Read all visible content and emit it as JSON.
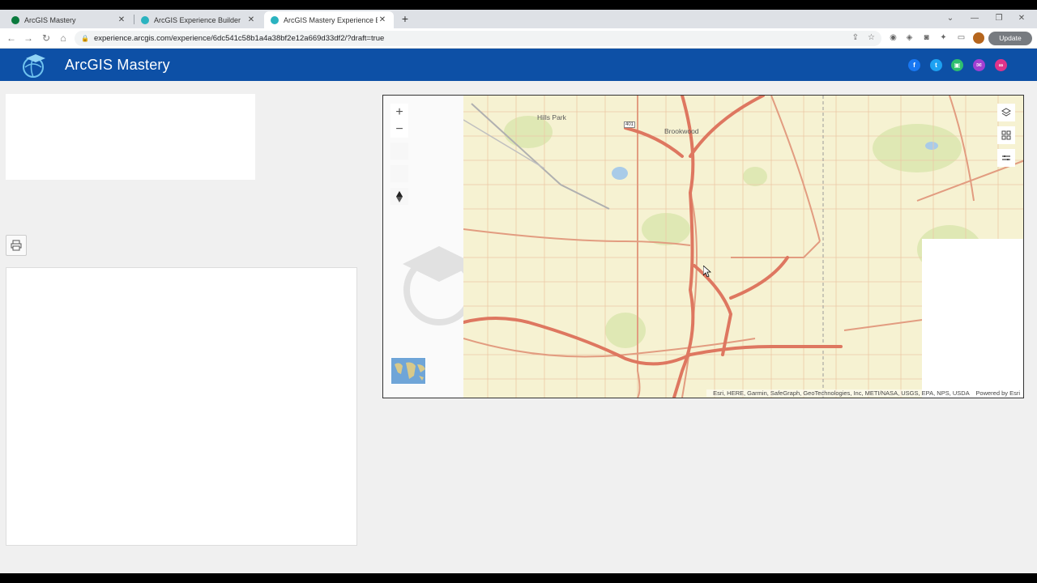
{
  "browser": {
    "tabs": [
      {
        "title": "ArcGIS Mastery",
        "fav_color": "#0b7a3e",
        "active": false
      },
      {
        "title": "ArcGIS Experience Builder",
        "fav_color": "#2bb3c0",
        "active": false
      },
      {
        "title": "ArcGIS Mastery Experience Builder",
        "fav_color": "#2bb3c0",
        "active": true
      }
    ],
    "url": "experience.arcgis.com/experience/6dc541c58b1a4a38bf2e12a669d33df2/?draft=true",
    "update_label": "Update"
  },
  "app": {
    "title": "ArcGIS Mastery",
    "header_color": "#0d50a6",
    "social": [
      {
        "icon": "facebook-icon",
        "glyph": "f",
        "color": "#1877f2"
      },
      {
        "icon": "twitter-icon",
        "glyph": "t",
        "color": "#1da1f2"
      },
      {
        "icon": "share-icon",
        "glyph": "▣",
        "color": "#2ebf6e"
      },
      {
        "icon": "email-icon",
        "glyph": "✉",
        "color": "#a23fd1"
      },
      {
        "icon": "link-icon",
        "glyph": "∞",
        "color": "#e0338a"
      }
    ]
  },
  "map": {
    "labels": [
      "Hills Park",
      "Brookwood",
      "401"
    ],
    "attribution": "Esri, HERE, Garmin, SafeGraph, GeoTechnologies, Inc, METI/NASA, USGS, EPA, NPS, USDA",
    "powered_by": "Powered by Esri",
    "zoom_in": "+",
    "zoom_out": "−",
    "tools": [
      "layers-icon",
      "basemap-gallery-icon",
      "legend-icon"
    ]
  }
}
